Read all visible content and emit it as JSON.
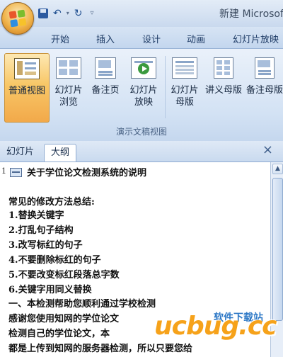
{
  "window": {
    "title": "新建 Microsoft"
  },
  "ribbon": {
    "tabs": [
      "开始",
      "插入",
      "设计",
      "动画",
      "幻灯片放映"
    ],
    "buttons": [
      {
        "label1": "普通视图",
        "label2": "",
        "active": true
      },
      {
        "label1": "幻灯片",
        "label2": "浏览",
        "active": false
      },
      {
        "label1": "备注页",
        "label2": "",
        "active": false
      },
      {
        "label1": "幻灯片",
        "label2": "放映",
        "active": false
      },
      {
        "label1": "幻灯片",
        "label2": "母版",
        "active": false
      },
      {
        "label1": "讲义母版",
        "label2": "",
        "active": false
      },
      {
        "label1": "备注母版",
        "label2": "",
        "active": false
      }
    ],
    "group_label": "演示文稿视图"
  },
  "pane": {
    "tab_slides": "幻灯片",
    "tab_outline": "大纲",
    "close": "×"
  },
  "outline": {
    "slide_number": "1",
    "title": "关于学位论文检测系统的说明",
    "lines": [
      "常见的修改方法总结:",
      "1.替换关键字",
      "2.打乱句子结构",
      "3.改写标红的句子",
      "4.不要删除标红的句子",
      "5.不要改变标红段落总字数",
      "6.关键字用同义替换",
      "一、本检测帮助您顺利通过学校检测",
      "感谢您使用知网的学位论文",
      "检测自己的学位论文，本",
      "都是上传到知网的服务器检测，所以只要您给"
    ]
  },
  "watermark": {
    "logo": "ucbug.cc",
    "sub": "软件下载站"
  },
  "colors": {
    "accent": "#f8c767",
    "ribbon": "#d3e2f4",
    "watermark_orange": "#f6a21a"
  }
}
